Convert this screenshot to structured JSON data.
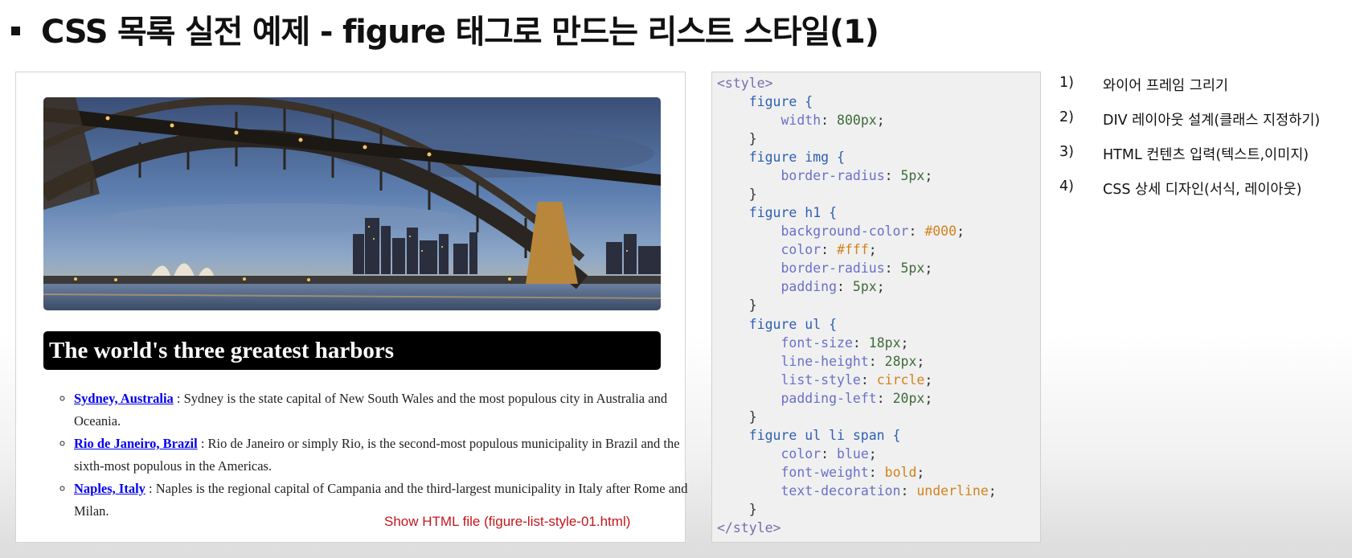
{
  "slide": {
    "title": "CSS 목록 실전 예제 - figure 태그로 만드는 리스트 스타일(1)"
  },
  "preview": {
    "image_alt": "Sydney Harbour Bridge at dusk",
    "heading": "The world's three greatest harbors",
    "items": [
      {
        "place": "Sydney, Australia",
        "text": " : Sydney is the state capital of New South Wales and the most populous city in Australia and Oceania."
      },
      {
        "place": "Rio de Janeiro, Brazil",
        "text": " : Rio de Janeiro or simply Rio, is the second-most populous municipality in Brazil and the sixth-most populous in the Americas."
      },
      {
        "place": "Naples, Italy",
        "text": " : Naples is the regional capital of Campania and the third-largest municipality in Italy after Rome and Milan."
      }
    ],
    "show_file": "Show HTML file (figure-list-style-01.html)"
  },
  "code": {
    "lines": [
      "<style>",
      "    figure {",
      "        width: 800px;",
      "    }",
      "    figure img {",
      "        border-radius: 5px;",
      "    }",
      "    figure h1 {",
      "        background-color: #000;",
      "        color: #fff;",
      "        border-radius: 5px;",
      "        padding: 5px;",
      "    }",
      "    figure ul {",
      "        font-size: 18px;",
      "        line-height: 28px;",
      "        list-style: circle;",
      "        padding-left: 20px;",
      "    }",
      "    figure ul li span {",
      "        color: blue;",
      "        font-weight: bold;",
      "        text-decoration: underline;",
      "    }",
      "</style>"
    ]
  },
  "steps": [
    {
      "num": "1)",
      "label": "와이어 프레임 그리기"
    },
    {
      "num": "2)",
      "label": "DIV 레이아웃 설계(클래스 지정하기)"
    },
    {
      "num": "3)",
      "label": "HTML 컨텐츠 입력(텍스트,이미지)"
    },
    {
      "num": "4)",
      "label": "CSS 상세 디자인(서식, 레이아웃)"
    }
  ]
}
